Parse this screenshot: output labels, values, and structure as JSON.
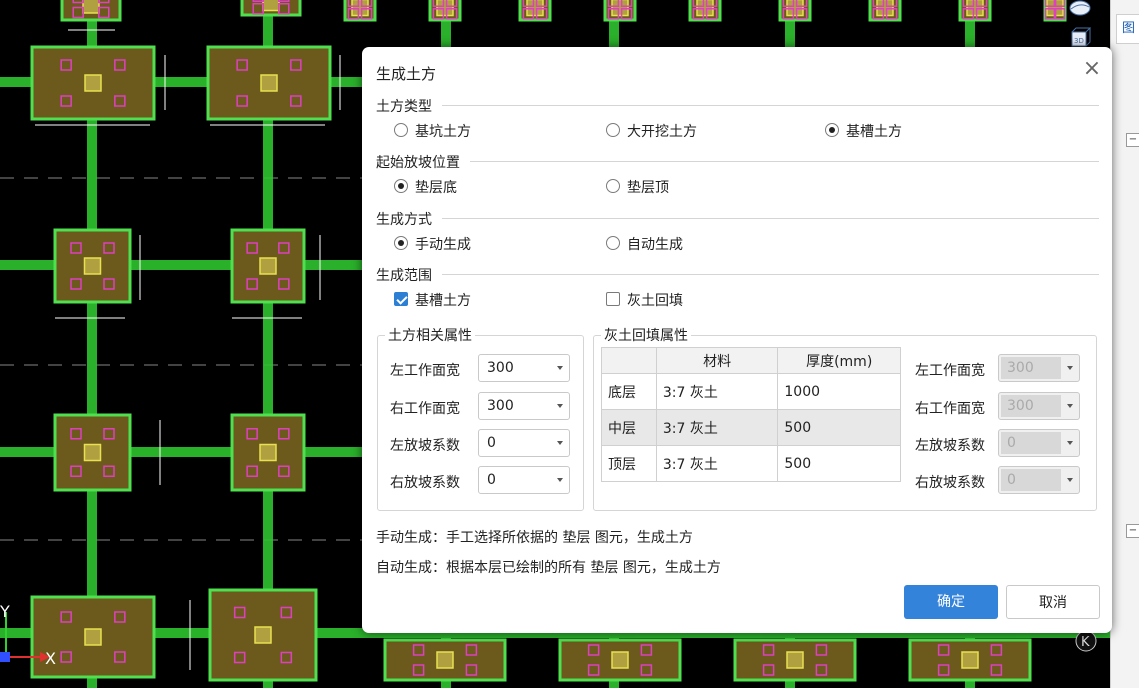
{
  "dialog": {
    "title": "生成土方",
    "soil_type": {
      "label": "土方类型",
      "options": [
        {
          "label": "基坑土方",
          "selected": false
        },
        {
          "label": "大开挖土方",
          "selected": false
        },
        {
          "label": "基槽土方",
          "selected": true
        }
      ]
    },
    "slope_start": {
      "label": "起始放坡位置",
      "options": [
        {
          "label": "垫层底",
          "selected": true
        },
        {
          "label": "垫层顶",
          "selected": false
        }
      ]
    },
    "gen_mode": {
      "label": "生成方式",
      "options": [
        {
          "label": "手动生成",
          "selected": true
        },
        {
          "label": "自动生成",
          "selected": false
        }
      ]
    },
    "gen_range": {
      "label": "生成范围",
      "options": [
        {
          "label": "基槽土方",
          "checked": true
        },
        {
          "label": "灰土回填",
          "checked": false
        }
      ]
    },
    "earth_props": {
      "title": "土方相关属性",
      "fields": [
        {
          "label": "左工作面宽",
          "value": "300"
        },
        {
          "label": "右工作面宽",
          "value": "300"
        },
        {
          "label": "左放坡系数",
          "value": "0"
        },
        {
          "label": "右放坡系数",
          "value": "0"
        }
      ]
    },
    "backfill_props": {
      "title": "灰土回填属性",
      "columns": [
        "",
        "材料",
        "厚度(mm)"
      ],
      "rows": [
        {
          "layer": "底层",
          "material": "3:7 灰土",
          "thickness": "1000"
        },
        {
          "layer": "中层",
          "material": "3:7 灰土",
          "thickness": "500"
        },
        {
          "layer": "顶层",
          "material": "3:7 灰土",
          "thickness": "500"
        }
      ],
      "fields": [
        {
          "label": "左工作面宽",
          "value": "300"
        },
        {
          "label": "右工作面宽",
          "value": "300"
        },
        {
          "label": "左放坡系数",
          "value": "0"
        },
        {
          "label": "右放坡系数",
          "value": "0"
        }
      ]
    },
    "notes": [
      "手动生成：手工选择所依据的 垫层 图元，生成土方",
      "自动生成：根据本层已绘制的所有 垫层 图元，生成土方"
    ],
    "ok_label": "确定",
    "cancel_label": "取消"
  },
  "side_panel": {
    "tab_label": "图元"
  },
  "axis": {
    "x_label": "X",
    "y_label": "Y"
  },
  "colors": {
    "canvas": "#000000",
    "footing_fill": "#6b5a1c",
    "footing_edge": "#4fe04f",
    "beam": "#2fc42f",
    "accent": "#3483da"
  }
}
